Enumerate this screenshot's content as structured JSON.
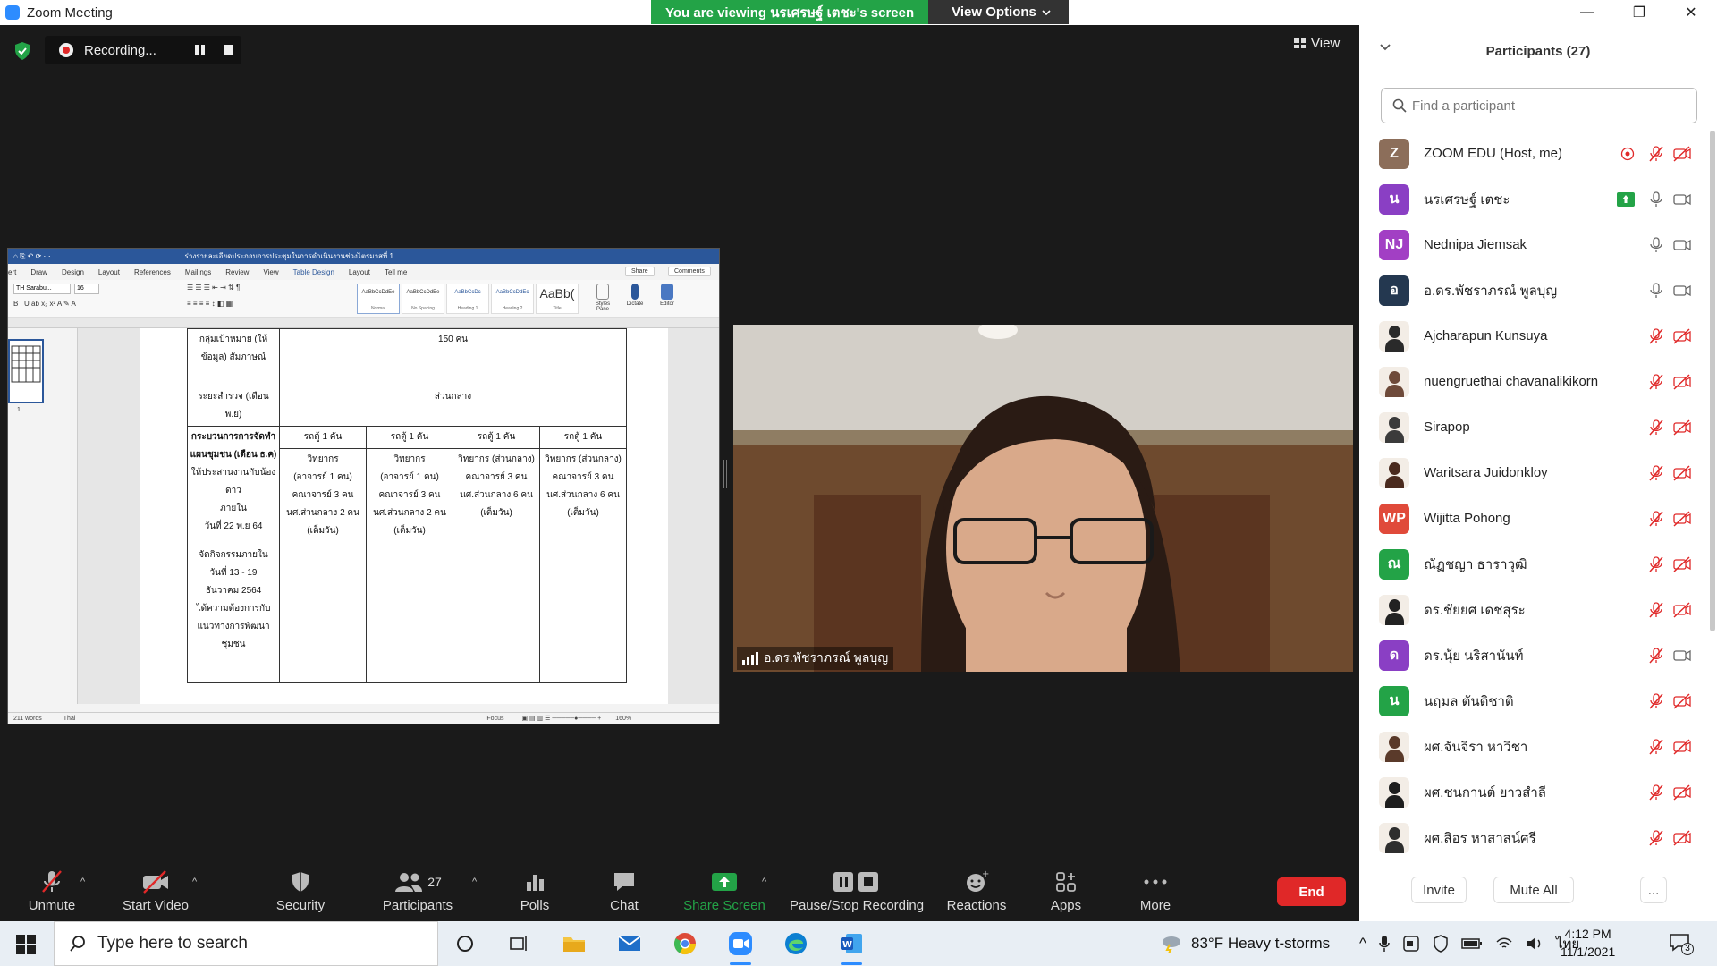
{
  "window": {
    "title": "Zoom Meeting",
    "controls": [
      "—",
      "❐",
      "✕"
    ]
  },
  "banner": {
    "viewing_text": "You are viewing นรเศรษฐ์ เตชะ's screen",
    "view_options_label": "View Options"
  },
  "recording": {
    "label": "Recording..."
  },
  "view_button": {
    "label": "View"
  },
  "shared_document": {
    "title": "ร่างรายละเอียดประกอบการประชุมในการดำเนินงานช่วงไตรมาสที่ 1",
    "ribbon_tabs": [
      "ert",
      "Draw",
      "Design",
      "Layout",
      "References",
      "Mailings",
      "Review",
      "View",
      "Table Design",
      "Layout",
      "Tell me"
    ],
    "share_label": "Share",
    "comments_label": "Comments",
    "font_name": "TH Sarabu...",
    "font_size": "16",
    "styles": [
      {
        "sample": "AaBbCcDdEe",
        "name": "Normal"
      },
      {
        "sample": "AaBbCcDdEe",
        "name": "No Spacing"
      },
      {
        "sample": "AaBbCcDc",
        "name": "Heading 1"
      },
      {
        "sample": "AaBbCcDdEc",
        "name": "Heading 2"
      },
      {
        "sample": "AaBb(",
        "name": "Title"
      }
    ],
    "ribbon_tools": [
      "Styles Pane",
      "Dictate",
      "Editor"
    ],
    "thumbnail_page": "1",
    "table": {
      "row1": {
        "label": "กลุ่มเป้าหมาย (ให้ข้อมูล) สัมภาษณ์",
        "value": "150 คน"
      },
      "row2": {
        "label": "ระยะสำรวจ (เดือน พ.ย)",
        "value": "ส่วนกลาง"
      },
      "row3": {
        "label_bold": "กระบวนการการจัดทำแผนชุมชน (เดือน ธ.ค)",
        "label_lines": [
          "ให้ประสานงานกับน้องดาว",
          "ภายใน",
          "วันที่ 22 พ.ย 64",
          "",
          "จัดกิจกรรมภายใน",
          "วันที่ 13 - 19",
          "ธันวาคม 2564",
          "ได้ความต้องการกับ",
          "แนวทางการพัฒนา",
          "ชุมชน"
        ],
        "columns": [
          {
            "head": "รถตู้ 1 คัน",
            "lines": [
              "วิทยากร",
              "(อาจารย์ 1 คน)",
              "คณาจารย์ 3 คน",
              "นศ.ส่วนกลาง 2 คน",
              "(เต็มวัน)"
            ]
          },
          {
            "head": "รถตู้ 1 คัน",
            "lines": [
              "วิทยากร",
              "(อาจารย์ 1 คน)",
              "คณาจารย์ 3 คน",
              "นศ.ส่วนกลาง 2 คน",
              "(เต็มวัน)"
            ]
          },
          {
            "head": "รถตู้ 1 คัน",
            "lines": [
              "วิทยากร (ส่วนกลาง)",
              "คณาจารย์ 3 คน",
              "นศ.ส่วนกลาง 6 คน",
              "(เต็มวัน)"
            ]
          },
          {
            "head": "รถตู้ 1 คัน",
            "lines": [
              "วิทยากร (ส่วนกลาง)",
              "คณาจารย์ 3 คน",
              "นศ.ส่วนกลาง 6 คน",
              "(เต็มวัน)"
            ]
          }
        ]
      }
    },
    "status": {
      "words": "211 words",
      "language": "Thai",
      "focus": "Focus",
      "zoom": "160%"
    }
  },
  "video_tile": {
    "name": "อ.ดร.พัชราภรณ์ พูลบุญ"
  },
  "participants": {
    "title": "Participants (27)",
    "search_placeholder": "Find a participant",
    "list": [
      {
        "initials": "Z",
        "color": "#8c6e5a",
        "name": "ZOOM EDU (Host, me)",
        "mic": "muted",
        "cam": "off",
        "extra": "rec"
      },
      {
        "initials": "น",
        "color": "#8a3fc4",
        "name": "นรเศรษฐ์ เตชะ",
        "mic": "on",
        "cam": "on",
        "extra": "share"
      },
      {
        "initials": "NJ",
        "color": "#a23fc4",
        "name": "Nednipa Jiemsak",
        "mic": "on",
        "cam": "on"
      },
      {
        "initials": "อ",
        "color": "#243850",
        "name": "อ.ดร.พัชราภรณ์ พูลบุญ",
        "mic": "on",
        "cam": "on"
      },
      {
        "photo": true,
        "color": "#2a2a2a",
        "name": "Ajcharapun Kunsuya",
        "mic": "muted",
        "cam": "off"
      },
      {
        "photo": true,
        "color": "#6e4a3a",
        "name": "nuengruethai chavanalikikorn",
        "mic": "muted",
        "cam": "off"
      },
      {
        "photo": true,
        "color": "#3b3b3b",
        "name": "Sirapop",
        "mic": "muted",
        "cam": "off"
      },
      {
        "photo": true,
        "color": "#4a2a1e",
        "name": "Waritsara Juidonkloy",
        "mic": "muted",
        "cam": "off"
      },
      {
        "initials": "WP",
        "color": "#e04a3a",
        "name": "Wijitta Pohong",
        "mic": "muted",
        "cam": "off"
      },
      {
        "initials": "ณ",
        "color": "#23a347",
        "name": "ณัฏชญา ธาราวุฒิ",
        "mic": "muted",
        "cam": "off"
      },
      {
        "photo": true,
        "color": "#222222",
        "name": "ดร.ชัยยศ เดชสุระ",
        "mic": "muted",
        "cam": "off"
      },
      {
        "initials": "ด",
        "color": "#8a3fc4",
        "name": "ดร.นุ้ย นริสานันท์",
        "mic": "muted",
        "cam": "on"
      },
      {
        "initials": "น",
        "color": "#23a347",
        "name": "นฤมล ตันติชาติ",
        "mic": "muted",
        "cam": "off"
      },
      {
        "photo": true,
        "color": "#5a3a2a",
        "name": "ผศ.จันจิรา หาวิชา",
        "mic": "muted",
        "cam": "off"
      },
      {
        "photo": true,
        "color": "#1e1e1e",
        "name": "ผศ.ชนกานต์ ยาวสำลี",
        "mic": "muted",
        "cam": "off"
      },
      {
        "photo": true,
        "color": "#2e2e2e",
        "name": "ผศ.สิอร หาสาสน์ศรี",
        "mic": "muted",
        "cam": "off"
      }
    ],
    "invite_label": "Invite",
    "mute_all_label": "Mute All",
    "more_label": "..."
  },
  "toolbar": {
    "unmute": "Unmute",
    "start_video": "Start Video",
    "security": "Security",
    "participants": "Participants",
    "participants_count": "27",
    "polls": "Polls",
    "chat": "Chat",
    "share_screen": "Share Screen",
    "pause_stop_recording": "Pause/Stop Recording",
    "reactions": "Reactions",
    "apps": "Apps",
    "more": "More",
    "end": "End"
  },
  "taskbar": {
    "search_placeholder": "Type here to search",
    "weather": "83°F  Heavy t-storms",
    "language": "ไทย",
    "time": "4:12 PM",
    "date": "11/1/2021",
    "notifications": "3"
  },
  "colors": {
    "zoom_blue": "#2d8cff",
    "green": "#23a347",
    "red": "#e02828",
    "word_blue": "#2b579a"
  }
}
